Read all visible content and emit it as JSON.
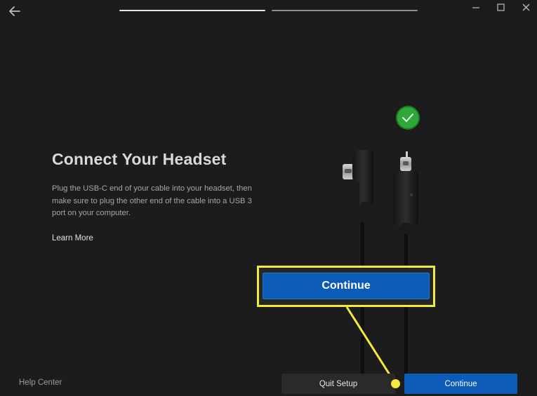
{
  "window": {
    "progress_steps": 2,
    "current_step": 1
  },
  "icons": {
    "back": "arrow-left-icon",
    "minimize": "minimize-icon",
    "maximize": "maximize-icon",
    "close": "close-icon",
    "check": "checkmark-icon"
  },
  "content": {
    "title": "Connect Your Headset",
    "description": "Plug the USB-C end of your cable into your headset, then make sure to plug the other end of the cable into a USB 3 port on your computer.",
    "learn_more": "Learn More"
  },
  "callout": {
    "zoomed_button_label": "Continue",
    "highlight_color": "#f4ea3a"
  },
  "footer": {
    "help_center": "Help Center",
    "quit_setup": "Quit Setup",
    "continue": "Continue"
  },
  "colors": {
    "background": "#1c1c1c",
    "primary_button": "#0b5bb7",
    "success_badge": "#2fa83a"
  }
}
